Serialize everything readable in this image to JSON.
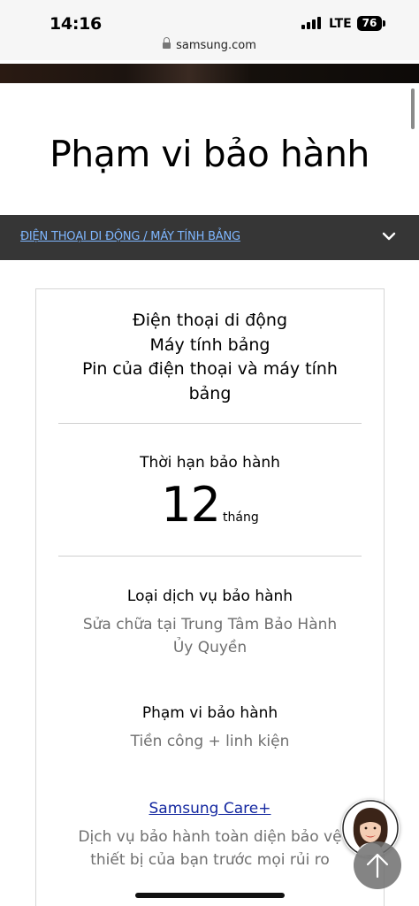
{
  "status_bar": {
    "time": "14:16",
    "network": "LTE",
    "battery": "76"
  },
  "browser": {
    "url": "samsung.com"
  },
  "page": {
    "title": "Phạm vi bảo hành"
  },
  "category_selector": {
    "label": "ĐIỆN THOẠI DI ĐỘNG / MÁY TÍNH BẢNG"
  },
  "warranty_card": {
    "heading_lines": [
      "Điện thoại di động",
      "Máy tính bảng",
      "Pin của điện thoại và máy tính bảng"
    ],
    "period_label": "Thời hạn bảo hành",
    "period_value": "12",
    "period_unit": "tháng",
    "service_type_label": "Loại dịch vụ bảo hành",
    "service_type_value": "Sửa chữa tại Trung Tâm Bảo Hành Ủy Quyền",
    "coverage_label": "Phạm vi bảo hành",
    "coverage_value": "Tiền công + linh kiện",
    "care_link": "Samsung Care+",
    "care_description": "Dịch vụ bảo hành toàn diện bảo vệ thiết bị của bạn trước mọi rủi ro"
  },
  "colors": {
    "link_blue": "#1428a0",
    "category_bar_bg": "#363636",
    "category_link": "#7fb7ff"
  },
  "icons": {
    "chevron": "chevron-down-icon",
    "back_to_top": "arrow-up-icon",
    "chat": "chat-assistant-avatar"
  }
}
